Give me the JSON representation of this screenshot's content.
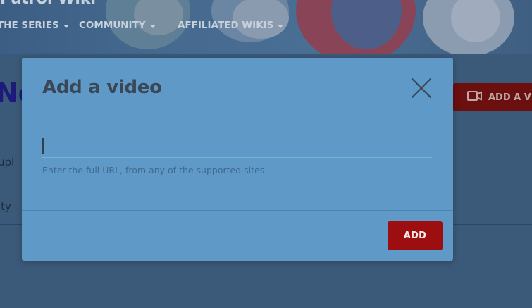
{
  "wiki": {
    "title": "Patrol Wiki"
  },
  "nav": {
    "items": [
      {
        "label": "THE SERIES"
      },
      {
        "label": "COMMUNITY"
      },
      {
        "label": "AFFILIATED WIKIS"
      }
    ]
  },
  "page": {
    "heading": "New",
    "text_upload": "upl",
    "text_activity": "ity",
    "add_video_button": "ADD A VIDEO"
  },
  "modal": {
    "title": "Add a video",
    "url_input": {
      "value": "",
      "placeholder": ""
    },
    "hint": "Enter the full URL, from any of the supported sites.",
    "add_button": "ADD"
  },
  "colors": {
    "modal_bg": "#5e99c7",
    "add_button": "#9c0e0f",
    "overlay_bg": "#3b5a79"
  },
  "icons": {
    "close": "close-icon",
    "caret": "chevron-down-icon",
    "video": "video-camera-icon"
  }
}
